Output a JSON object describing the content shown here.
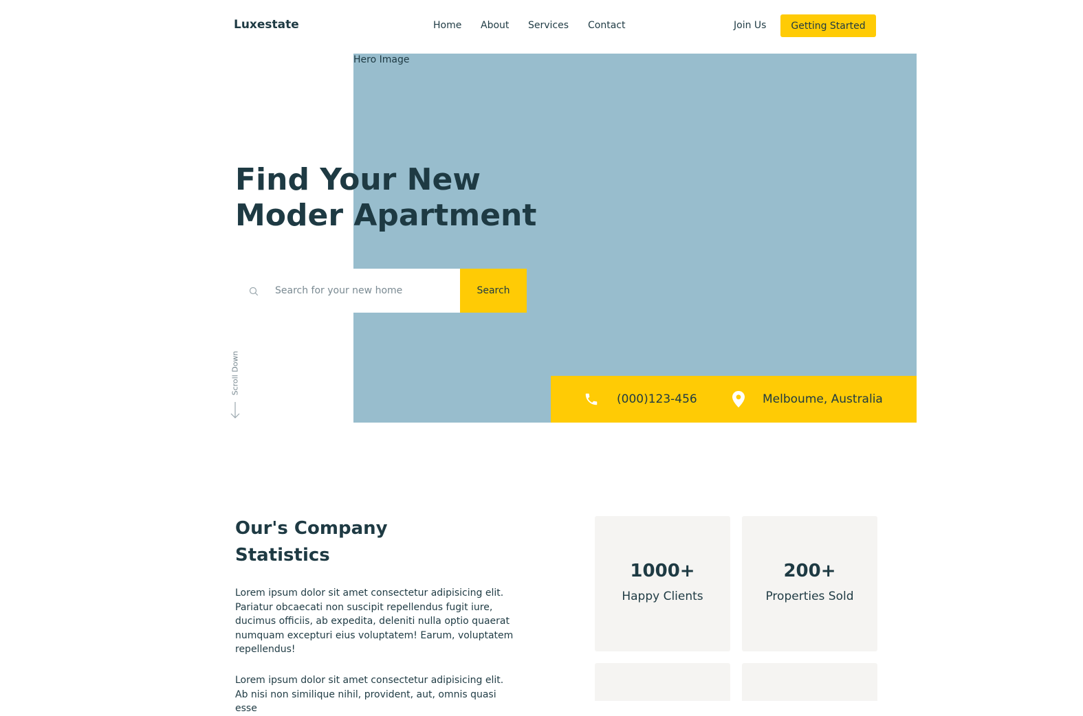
{
  "header": {
    "logo": "Luxestate",
    "nav": [
      "Home",
      "About",
      "Services",
      "Contact"
    ],
    "join": "Join Us",
    "cta": "Getting Started"
  },
  "hero": {
    "image_label": "Hero Image",
    "title": "Find Your New Moder Apartment",
    "search": {
      "placeholder": "Search for your new home",
      "button": "Search"
    },
    "scroll": "Scroll Down",
    "contact": {
      "phone": "(000)123-456",
      "location": "Melboume, Australia"
    }
  },
  "stats": {
    "title": "Our's Company Statistics",
    "paragraphs": [
      "Lorem ipsum dolor sit amet consectetur adipisicing elit. Pariatur obcaecati non suscipit repellendus fugit iure, ducimus officiis, ab expedita, deleniti nulla optio quaerat numquam excepturi eius voluptatem! Earum, voluptatem repellendus!",
      "Lorem ipsum dolor sit amet consectetur adipisicing elit. Ab nisi non similique nihil, provident, aut, omnis quasi esse"
    ],
    "cards": [
      {
        "value": "1000+",
        "label": "Happy Clients"
      },
      {
        "value": "200+",
        "label": "Properties Sold"
      },
      {
        "value": "",
        "label": ""
      },
      {
        "value": "",
        "label": ""
      }
    ]
  },
  "colors": {
    "accent": "#ffcb05",
    "text": "#1e3a43",
    "hero_image": "#98bdcd",
    "card_bg": "#f5f4f2"
  },
  "icons": [
    "search-icon",
    "phone-icon",
    "location-pin-icon",
    "arrow-down-icon"
  ]
}
